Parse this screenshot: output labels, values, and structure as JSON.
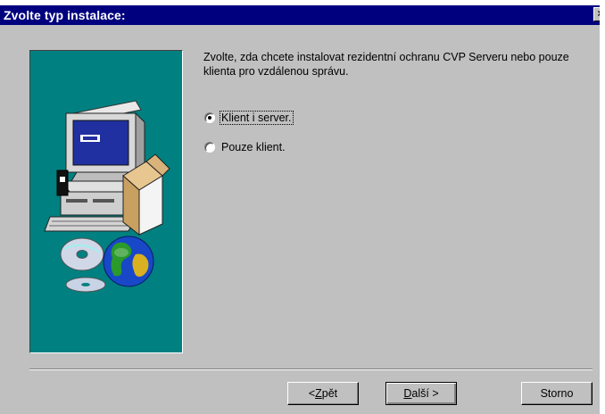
{
  "window": {
    "title": "Zvolte typ instalace:",
    "close_glyph": "×"
  },
  "description": "Zvolte, zda chcete instalovat rezidentní ochranu CVP Serveru nebo pouze klienta pro vzdálenou správu.",
  "options": [
    {
      "label": "Klient i server.",
      "selected": true
    },
    {
      "label": "Pouze klient.",
      "selected": false
    }
  ],
  "buttons": {
    "back": {
      "mnemonic": "Z",
      "rest": "pět",
      "prefix": "< "
    },
    "next": {
      "mnemonic": "D",
      "rest": "alší >"
    },
    "cancel": "Storno"
  },
  "colors": {
    "titlebar": "#00007f",
    "face": "#c0c0c0",
    "art_background": "#008080"
  },
  "icons": [
    "computer-illustration",
    "cd-disc-icon",
    "globe-icon"
  ]
}
